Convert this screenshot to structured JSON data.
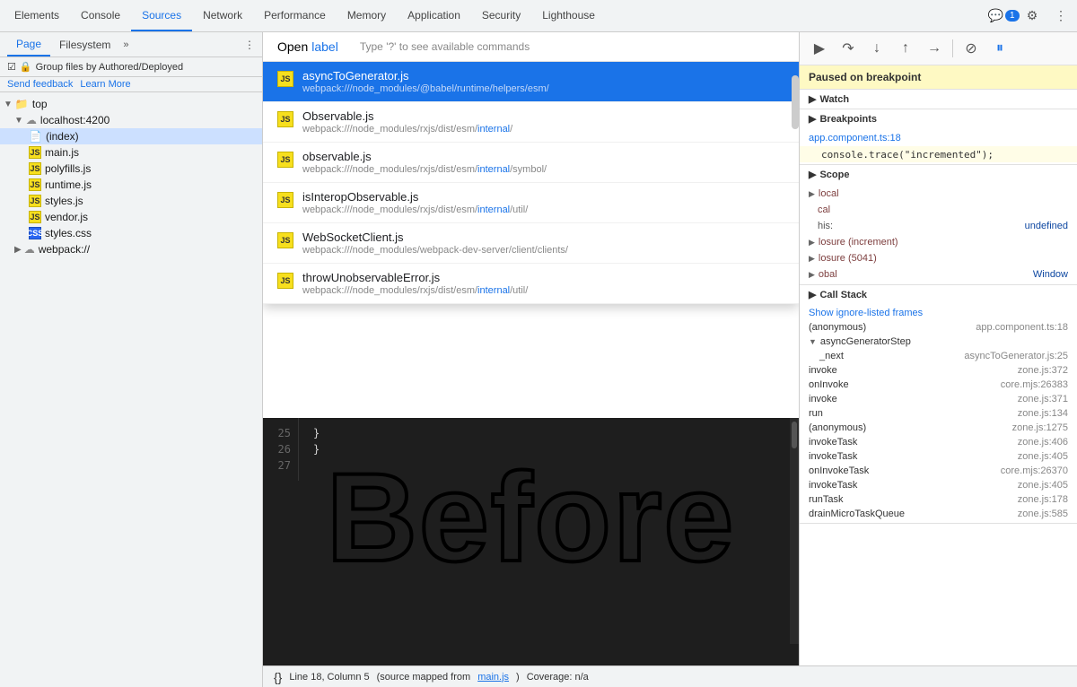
{
  "tabs": {
    "items": [
      {
        "label": "Elements",
        "active": false
      },
      {
        "label": "Console",
        "active": false
      },
      {
        "label": "Sources",
        "active": true
      },
      {
        "label": "Network",
        "active": false
      },
      {
        "label": "Performance",
        "active": false
      },
      {
        "label": "Memory",
        "active": false
      },
      {
        "label": "Application",
        "active": false
      },
      {
        "label": "Security",
        "active": false
      },
      {
        "label": "Lighthouse",
        "active": false
      }
    ],
    "badge_count": "1"
  },
  "subtabs": {
    "page": "Page",
    "filesystem": "Filesystem"
  },
  "sidebar": {
    "group_label": "Group files by Authored/Deployed",
    "send_feedback": "Send feedback",
    "learn_more": "Learn More",
    "tree": [
      {
        "label": "top",
        "level": 0,
        "type": "folder",
        "expanded": true
      },
      {
        "label": "localhost:4200",
        "level": 1,
        "type": "cloud",
        "expanded": true
      },
      {
        "label": "(index)",
        "level": 2,
        "type": "file",
        "selected": true
      },
      {
        "label": "main.js",
        "level": 2,
        "type": "js"
      },
      {
        "label": "polyfills.js",
        "level": 2,
        "type": "js"
      },
      {
        "label": "runtime.js",
        "level": 2,
        "type": "js"
      },
      {
        "label": "styles.js",
        "level": 2,
        "type": "js"
      },
      {
        "label": "vendor.js",
        "level": 2,
        "type": "js"
      },
      {
        "label": "styles.css",
        "level": 2,
        "type": "css"
      },
      {
        "label": "webpack://",
        "level": 1,
        "type": "cloud",
        "expanded": false
      }
    ]
  },
  "autocomplete": {
    "open_label": "Open",
    "input_value": "label",
    "hint": "Type '?' to see available commands",
    "items": [
      {
        "filename": "asyncToGenerator.js",
        "path": "webpack:///node_modules/@babel/runtime/helpers/esm/",
        "path_highlight": "",
        "selected": true
      },
      {
        "filename": "Observable.js",
        "path": "webpack:///node_modules/rxjs/dist/esm/internal/",
        "path_highlight": "internal",
        "selected": false
      },
      {
        "filename": "observable.js",
        "path": "webpack:///node_modules/rxjs/dist/esm/internal/symbol/",
        "path_highlight": "internal",
        "selected": false
      },
      {
        "filename": "isInteropObservable.js",
        "path": "webpack:///node_modules/rxjs/dist/esm/internal/util/",
        "path_highlight": "internal",
        "selected": false
      },
      {
        "filename": "WebSocketClient.js",
        "path": "webpack:///node_modules/webpack-dev-server/client/clients/",
        "path_highlight": "",
        "selected": false
      },
      {
        "filename": "throwUnobservableError.js",
        "path": "webpack:///node_modules/rxjs/dist/esm/internal/util/",
        "path_highlight": "internal",
        "selected": false
      }
    ]
  },
  "code": {
    "lines": [
      {
        "num": "25",
        "content": "  }"
      },
      {
        "num": "26",
        "content": "}"
      },
      {
        "num": "27",
        "content": ""
      }
    ]
  },
  "before_text": "Before",
  "status_bar": {
    "line_col": "Line 18, Column 5",
    "source_mapped": "(source mapped from",
    "source_file": "main.js",
    "coverage": "Coverage: n/a"
  },
  "debugger": {
    "paused_label": "Paused on breakpoint",
    "watch_label": "Watch",
    "breakpoints_label": "Breakpoints",
    "breakpoint_file": "app.component.ts:18",
    "breakpoint_code": "console.trace(\"incremented\");",
    "scope_label": "Scope",
    "scope_items": [
      {
        "key": "local",
        "val": "",
        "type": "section"
      },
      {
        "key": "cal",
        "val": "",
        "type": "item"
      },
      {
        "key": "his:",
        "val": "undefined",
        "type": "item"
      },
      {
        "key": "osure (increment)",
        "val": "",
        "type": "item"
      },
      {
        "key": "osure (5041)",
        "val": "",
        "type": "item"
      },
      {
        "key": "obal",
        "val": "Window",
        "type": "item"
      }
    ],
    "call_stack_label": "Call Stack",
    "show_ignore": "Show ignore-listed frames",
    "call_stack_items": [
      {
        "name": "(anonymous)",
        "loc": "app.component.ts:18"
      },
      {
        "name": "asyncGeneratorStep",
        "loc": "",
        "expand": true
      },
      {
        "name": "_next",
        "loc": "asyncToGenerator.js:25"
      },
      {
        "name": "invoke",
        "loc": "zone.js:372"
      },
      {
        "name": "onInvoke",
        "loc": "core.mjs:26383"
      },
      {
        "name": "invoke",
        "loc": "zone.js:371"
      },
      {
        "name": "run",
        "loc": "zone.js:134"
      },
      {
        "name": "(anonymous)",
        "loc": "zone.js:1275"
      },
      {
        "name": "invokeTask",
        "loc": "zone.js:406"
      },
      {
        "name": "invokeTask",
        "loc": "zone.js:405"
      },
      {
        "name": "onInvokeTask",
        "loc": "core.mjs:26370"
      },
      {
        "name": "invokeTask",
        "loc": "zone.js:405"
      },
      {
        "name": "runTask",
        "loc": "zone.js:178"
      },
      {
        "name": "drainMicroTaskQueue",
        "loc": "zone.js:585"
      }
    ],
    "toolbar": {
      "resume": "▶",
      "step_over": "⤼",
      "step_into": "⬇",
      "step_out": "⬆",
      "step": "→",
      "deactivate": "⊘",
      "pause_on_exception": "⏸"
    }
  }
}
